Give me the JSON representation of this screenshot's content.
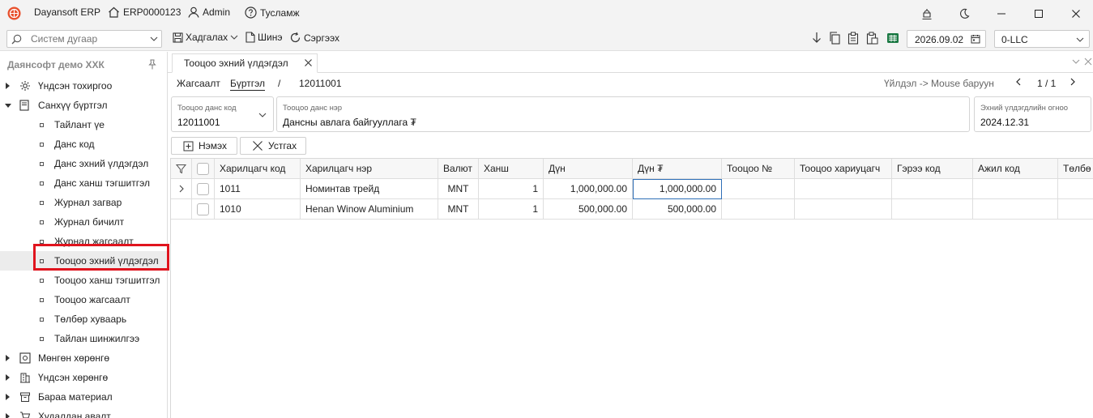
{
  "titlebar": {
    "app_name": "Dayansoft ERP",
    "system_code": "ERP0000123",
    "user": "Admin",
    "help": "Тусламж"
  },
  "toolbar": {
    "search_placeholder": "Систем дугаар",
    "save": "Хадгалах",
    "new": "Шинэ",
    "refresh": "Сэргээх",
    "date": "2026.09.02",
    "company": "0-LLC"
  },
  "sidebar": {
    "company_title": "Даянсофт демо ХХК",
    "items": [
      {
        "label": "Үндсэн тохиргоо",
        "level": 0,
        "expander": "collapsed",
        "icon": "gear-icon"
      },
      {
        "label": "Санхүү бүртгэл",
        "level": 0,
        "expander": "expanded",
        "icon": "ledger-icon"
      },
      {
        "label": "Тайлант үе",
        "level": 1
      },
      {
        "label": "Данс код",
        "level": 1
      },
      {
        "label": "Данс эхний үлдэгдэл",
        "level": 1
      },
      {
        "label": "Данс ханш тэгшитгэл",
        "level": 1
      },
      {
        "label": "Журнал загвар",
        "level": 1
      },
      {
        "label": "Журнал бичилт",
        "level": 1
      },
      {
        "label": "Журнал жагсаалт",
        "level": 1
      },
      {
        "label": "Тооцоо эхний үлдэгдэл",
        "level": 1,
        "selected": true
      },
      {
        "label": "Тооцоо ханш тэгшитгэл",
        "level": 1
      },
      {
        "label": "Тооцоо жагсаалт",
        "level": 1
      },
      {
        "label": "Төлбөр хуваарь",
        "level": 1
      },
      {
        "label": "Тайлан шинжилгээ",
        "level": 1
      },
      {
        "label": "Мөнгөн хөрөнгө",
        "level": 0,
        "expander": "collapsed",
        "icon": "cash-icon"
      },
      {
        "label": "Үндсэн хөрөнгө",
        "level": 0,
        "expander": "collapsed",
        "icon": "building-icon"
      },
      {
        "label": "Бараа материал",
        "level": 0,
        "expander": "collapsed",
        "icon": "box-icon"
      },
      {
        "label": "Худалдан авалт",
        "level": 0,
        "expander": "collapsed",
        "icon": "cart-icon"
      }
    ]
  },
  "tab": {
    "title": "Тооцоо эхний үлдэгдэл"
  },
  "breadcrumb": {
    "list": "Жагсаалт",
    "register": "Бүртгэл",
    "separator": "/",
    "code": "12011001",
    "hint": "Үйлдэл -> Mouse баруун",
    "pager": "1 / 1"
  },
  "form": {
    "account_code_label": "Тооцоо данс код",
    "account_code_value": "12011001",
    "account_name_label": "Тооцоо данс нэр",
    "account_name_value": "Дансны авлага байгууллага ₮",
    "opening_date_label": "Эхний үлдэгдлийн огноо",
    "opening_date_value": "2024.12.31"
  },
  "actions": {
    "add": "Нэмэх",
    "delete": "Устгах"
  },
  "grid": {
    "columns": [
      "Харилцагч код",
      "Харилцагч нэр",
      "Валют",
      "Ханш",
      "Дүн",
      "Дүн ₮",
      "Тооцоо №",
      "Тооцоо хариуцагч",
      "Гэрээ код",
      "Ажил код",
      "Төлбө"
    ],
    "rows": [
      {
        "code": "1011",
        "name": "Номинтав трейд",
        "currency": "MNT",
        "rate": "1",
        "amount": "1,000,000.00",
        "amount_mnt": "1,000,000.00",
        "ref": "",
        "owner": "",
        "contract": "",
        "job": "",
        "pay": ""
      },
      {
        "code": "1010",
        "name": "Henan Winow Aluminium",
        "currency": "MNT",
        "rate": "1",
        "amount": "500,000.00",
        "amount_mnt": "500,000.00",
        "ref": "",
        "owner": "",
        "contract": "",
        "job": "",
        "pay": ""
      }
    ]
  },
  "colors": {
    "highlight_box": "#e0141e",
    "titlebar_bg": "#f3f3f3",
    "logo": "#e8502c"
  }
}
